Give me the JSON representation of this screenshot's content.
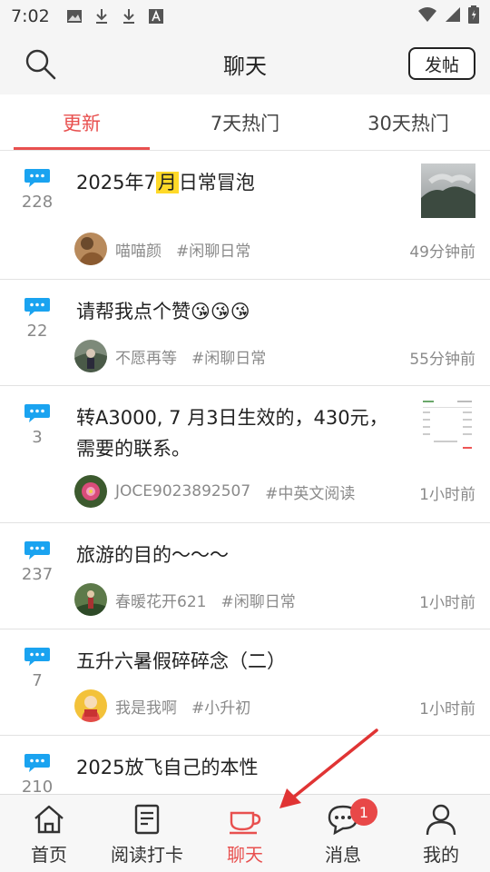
{
  "status": {
    "time": "7:02",
    "icons": [
      "image-icon",
      "download-icon",
      "download-icon",
      "font-icon"
    ],
    "right_icons": [
      "wifi-icon",
      "signal-icon",
      "battery-icon"
    ]
  },
  "header": {
    "title": "聊天",
    "post_label": "发帖"
  },
  "tabs": [
    {
      "label": "更新",
      "active": true
    },
    {
      "label": "7天热门",
      "active": false
    },
    {
      "label": "30天热门",
      "active": false
    }
  ],
  "posts": [
    {
      "count": "228",
      "title_a": "2025年7",
      "title_hl": "月",
      "title_b": "日常冒泡",
      "author": "喵喵颜",
      "tag": "#闲聊日常",
      "time": "49分钟前"
    },
    {
      "count": "22",
      "title": "请帮我点个赞😘😘😘",
      "author": "不愿再等",
      "tag": "#闲聊日常",
      "time": "55分钟前"
    },
    {
      "count": "3",
      "title_line1": "转A3000, 7 月3日生效的，430元，",
      "title_line2": "需要的联系。",
      "author": "JOCE9023892507",
      "tag": "#中英文阅读",
      "time": "1小时前"
    },
    {
      "count": "237",
      "title": "旅游的目的～～～",
      "author": "春暖花开621",
      "tag": "#闲聊日常",
      "time": "1小时前"
    },
    {
      "count": "7",
      "title": "五升六暑假碎碎念（二）",
      "author": "我是我啊",
      "tag": "#小升初",
      "time": "1小时前"
    },
    {
      "count": "210",
      "title": "2025放飞自己的本性"
    }
  ],
  "nav": [
    {
      "label": "首页",
      "icon": "home-icon"
    },
    {
      "label": "阅读打卡",
      "icon": "book-icon"
    },
    {
      "label": "聊天",
      "icon": "cup-icon",
      "active": true
    },
    {
      "label": "消息",
      "icon": "message-icon",
      "badge": "1"
    },
    {
      "label": "我的",
      "icon": "user-icon"
    }
  ],
  "colors": {
    "accent": "#e8504f",
    "bubble": "#1aa3f0",
    "highlight": "#ffd928"
  }
}
